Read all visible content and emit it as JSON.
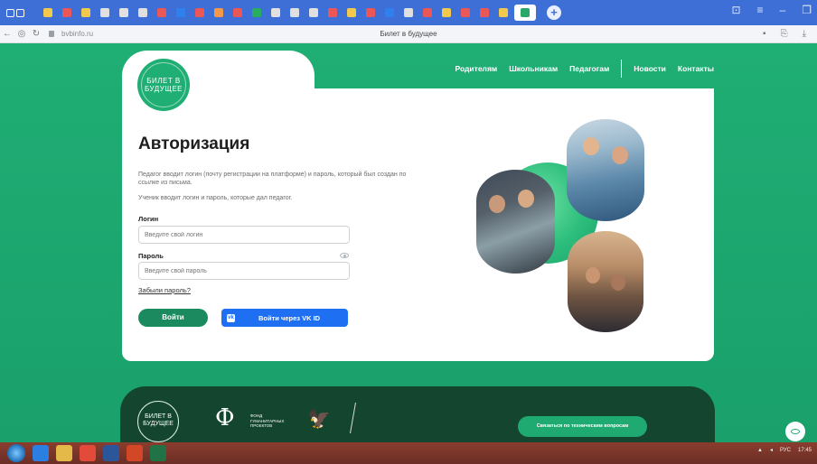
{
  "browser": {
    "page_title": "Билет в будущее",
    "url": "bvbinfo.ru"
  },
  "nav": {
    "items": [
      "Родителям",
      "Школьникам",
      "Педагогам"
    ],
    "items_right": [
      "Новости",
      "Контакты"
    ]
  },
  "logo": {
    "line1": "БИЛЕТ В",
    "line2": "БУДУЩЕЕ"
  },
  "auth": {
    "title": "Авторизация",
    "desc_teacher": "Педагог вводит логин (почту регистрации на платформе) и пароль, который был создан по ссылке из письма.",
    "desc_student": "Ученик вводит логин и пароль, которые дал педагог.",
    "login_label": "Логин",
    "login_placeholder": "Введите свой логин",
    "password_label": "Пароль",
    "password_placeholder": "Введите свой пароль",
    "forgot_link": "Забыли пароль?",
    "login_button": "Войти",
    "vk_button": "Войти через VK ID",
    "vk_icon_text": "vk"
  },
  "footer": {
    "logo_line1": "БИЛЕТ В",
    "logo_line2": "БУДУЩЕЕ",
    "fond_symbol": "Ф",
    "fond_text": "ФОНД ГУМАНИТАРНЫХ ПРОЕКТОВ",
    "contact_button": "Связаться по техническим вопросам"
  },
  "colors": {
    "brand_green": "#1faa72",
    "dark_green": "#14452f",
    "vk_blue": "#1f6ff2"
  },
  "taskbar": {
    "lang": "РУС",
    "time": "17:45"
  }
}
